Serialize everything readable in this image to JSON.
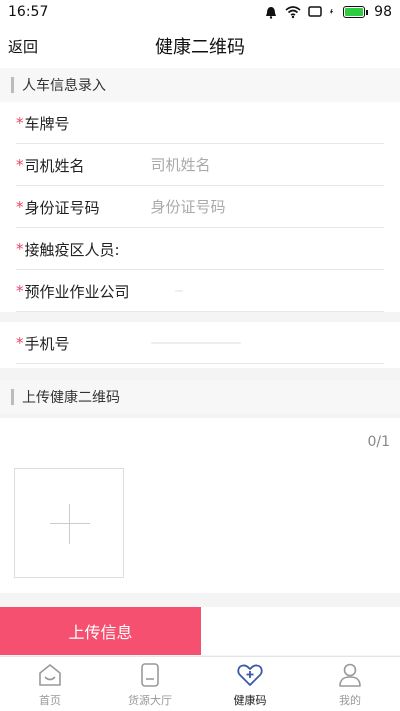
{
  "status_bar": {
    "time": "16:57",
    "battery": "98",
    "battery_level": 0.98
  },
  "header": {
    "back_label": "返回",
    "title": "健康二维码"
  },
  "section_info": {
    "title": "人车信息录入"
  },
  "form": {
    "required_mark": "*",
    "plate": {
      "label": "车牌号",
      "placeholder": ""
    },
    "driver": {
      "label": "司机姓名",
      "placeholder": "司机姓名"
    },
    "id_number": {
      "label": "身份证号码",
      "placeholder": "身份证号码"
    },
    "contact": {
      "label": "接触疫区人员:"
    },
    "company": {
      "label": "预作业作业公司"
    },
    "phone": {
      "label": "手机号"
    }
  },
  "section_upload": {
    "title": "上传健康二维码",
    "counter": "0/1"
  },
  "submit": {
    "label": "上传信息"
  },
  "tabbar": {
    "items": [
      {
        "label": "首页",
        "icon": "home-icon"
      },
      {
        "label": "货源大厅",
        "icon": "cargo-icon"
      },
      {
        "label": "健康码",
        "icon": "health-code-icon",
        "active": true
      },
      {
        "label": "我的",
        "icon": "profile-icon"
      }
    ]
  },
  "colors": {
    "accent": "#f5506f",
    "active_tab": "#3a5aa8"
  }
}
